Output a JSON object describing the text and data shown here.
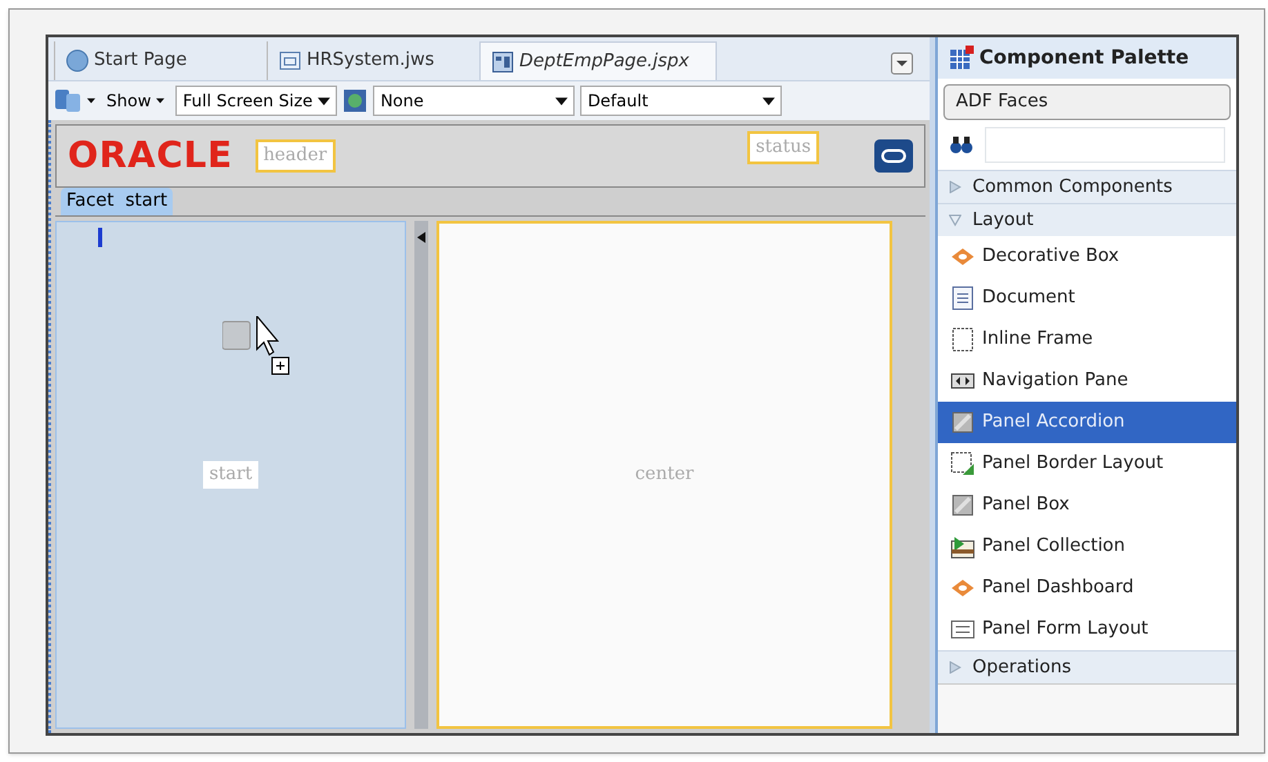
{
  "tabs": [
    {
      "label": "Start Page",
      "kind": "help",
      "selected": false
    },
    {
      "label": "HRSystem.jws",
      "kind": "workspace",
      "selected": false
    },
    {
      "label": "DeptEmpPage.jspx",
      "kind": "page",
      "selected": true
    }
  ],
  "toolbar": {
    "show": "Show",
    "size": "Full Screen Size",
    "skin": "None",
    "style": "Default"
  },
  "design": {
    "logo": "ORACLE",
    "header": "header",
    "status": "status",
    "facet_label": "Facet  start",
    "start": "start",
    "center": "center"
  },
  "palette": {
    "title": "Component Palette",
    "library": "ADF Faces",
    "sections": [
      {
        "label": "Common Components",
        "expanded": false
      },
      {
        "label": "Layout",
        "expanded": true,
        "items": [
          {
            "label": "Decorative Box",
            "kind": "diamond",
            "selected": false
          },
          {
            "label": "Document",
            "kind": "doc",
            "selected": false
          },
          {
            "label": "Inline Frame",
            "kind": "frame",
            "selected": false
          },
          {
            "label": "Navigation Pane",
            "kind": "nav",
            "selected": false
          },
          {
            "label": "Panel Accordion",
            "kind": "panel",
            "selected": true
          },
          {
            "label": "Panel Border Layout",
            "kind": "border",
            "selected": false
          },
          {
            "label": "Panel Box",
            "kind": "panel",
            "selected": false
          },
          {
            "label": "Panel Collection",
            "kind": "collection",
            "selected": false
          },
          {
            "label": "Panel Dashboard",
            "kind": "diamond",
            "selected": false
          },
          {
            "label": "Panel Form Layout",
            "kind": "form",
            "selected": false
          }
        ]
      },
      {
        "label": "Operations",
        "expanded": false
      }
    ]
  }
}
